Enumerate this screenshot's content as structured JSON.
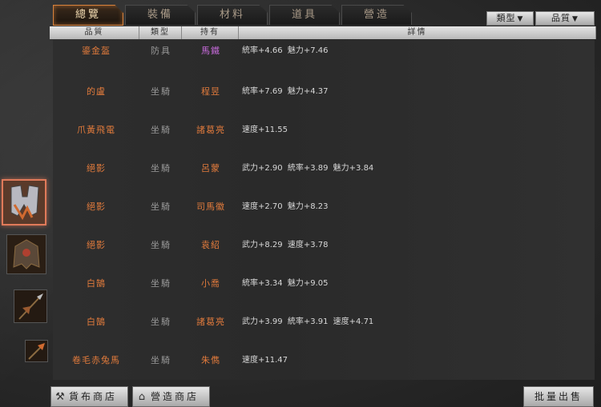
{
  "tabs": [
    {
      "label": "總覽",
      "active": true
    },
    {
      "label": "裝備",
      "active": false
    },
    {
      "label": "材料",
      "active": false
    },
    {
      "label": "道具",
      "active": false
    },
    {
      "label": "營造",
      "active": false
    }
  ],
  "filters": {
    "type_label": "類型",
    "quality_label": "品質"
  },
  "columns": [
    "品質",
    "類型",
    "持有",
    "詳情"
  ],
  "rows": [
    {
      "name": "鎏金盔",
      "type": "防具",
      "owner": "馬鐵",
      "owner_color": "purple",
      "detail": "統率+4.66 魅力+7.46"
    },
    {
      "name": "的盧",
      "type": "坐騎",
      "owner": "程昱",
      "owner_color": "orange",
      "detail": "統率+7.69 魅力+4.37"
    },
    {
      "name": "爪黃飛電",
      "type": "坐騎",
      "owner": "諸葛亮",
      "owner_color": "orange",
      "detail": "速度+11.55"
    },
    {
      "name": "絕影",
      "type": "坐騎",
      "owner": "呂蒙",
      "owner_color": "orange",
      "detail": "武力+2.90 統率+3.89 魅力+3.84"
    },
    {
      "name": "絕影",
      "type": "坐騎",
      "owner": "司馬徽",
      "owner_color": "orange",
      "detail": "速度+2.70 魅力+8.23"
    },
    {
      "name": "絕影",
      "type": "坐騎",
      "owner": "袁紹",
      "owner_color": "orange",
      "detail": "武力+8.29 速度+3.78"
    },
    {
      "name": "白鵠",
      "type": "坐騎",
      "owner": "小喬",
      "owner_color": "orange",
      "detail": "統率+3.34 魅力+9.05"
    },
    {
      "name": "白鵠",
      "type": "坐騎",
      "owner": "諸葛亮",
      "owner_color": "orange",
      "detail": "武力+3.99 統率+3.91 速度+4.71"
    },
    {
      "name": "卷毛赤兔馬",
      "type": "坐騎",
      "owner": "朱儁",
      "owner_color": "orange",
      "detail": "速度+11.47"
    }
  ],
  "side_icons": [
    "armor-icon",
    "helmet-icon",
    "spear-icon",
    "halberd-icon"
  ],
  "buttons": {
    "cloth_shop": "貨布商店",
    "build_shop": "營造商店",
    "bulk_sell": "批量出售"
  },
  "colors": {
    "accent": "#e07a3c",
    "purple": "#c46ad8",
    "active_tab_border": "#d8823c"
  }
}
